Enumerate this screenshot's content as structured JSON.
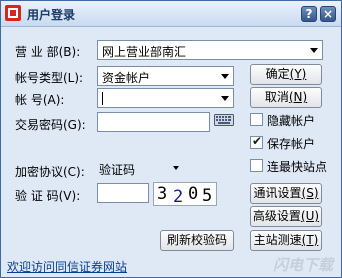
{
  "window": {
    "title": "用户登录"
  },
  "titlebar": {
    "help_label": "?",
    "close_label": "×"
  },
  "form": {
    "branch_label": "营 业 部(B):",
    "branch_value": "网上营业部南汇",
    "account_type_label": "帐号类型(L):",
    "account_type_value": "资金帐户",
    "account_label": "帐    号(A):",
    "account_value": "",
    "password_label": "交易密码(G):",
    "password_value": "",
    "encryption_label": "加密协议(C):",
    "encryption_value": "验证码",
    "captcha_label": "验 证 码(V):",
    "captcha_value": "",
    "captcha_chars": [
      "3",
      "2",
      "0",
      "5"
    ]
  },
  "buttons": {
    "confirm": {
      "text": "确定",
      "key": "(Y)"
    },
    "cancel": {
      "text": "取消",
      "key": "(N)"
    },
    "network_settings": {
      "text": "通讯设置",
      "key": "(S)"
    },
    "advanced_settings": {
      "text": "高级设置",
      "key": "(U)"
    },
    "speed_test": {
      "text": "主站测速",
      "key": "(T)"
    },
    "refresh_captcha": "刷新校验码"
  },
  "checkboxes": {
    "hide_account": {
      "label": "隐藏帐户",
      "checked": false
    },
    "save_account": {
      "label": "保存帐户",
      "checked": true
    },
    "fastest_site": {
      "label": "连最快站点",
      "checked": false
    }
  },
  "footer": {
    "welcome_link": "欢迎访问同信证券网站",
    "watermark": "闪电下载"
  },
  "colors": {
    "title_text": "#1c3a64",
    "link": "#0b3d8c",
    "window_bg": "#dfe9f6"
  }
}
